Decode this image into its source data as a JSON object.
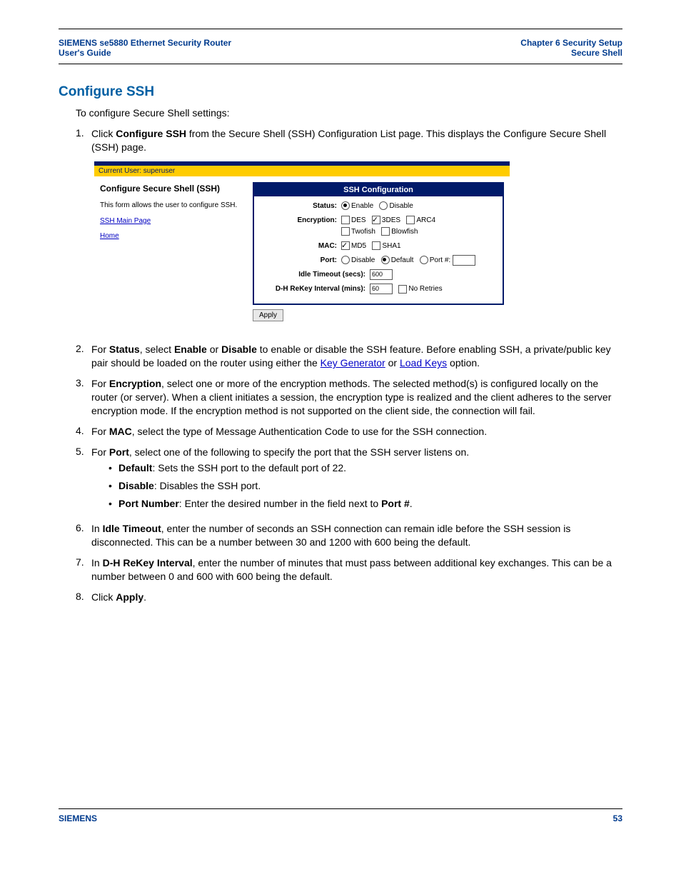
{
  "header": {
    "left1": "SIEMENS se5880 Ethernet Security Router",
    "left2": "User's Guide",
    "right1": "Chapter 6  Security Setup",
    "right2": "Secure Shell"
  },
  "section_title": "Configure SSH",
  "intro": "To configure Secure Shell settings:",
  "steps": {
    "s1a": "Click ",
    "s1b": "Configure SSH",
    "s1c": " from the Secure Shell (SSH) Configuration List page. This displays the Configure Secure Shell (SSH) page.",
    "s2a": "For ",
    "s2b": "Status",
    "s2c": ", select ",
    "s2d": "Enable",
    "s2e": " or ",
    "s2f": "Disable",
    "s2g": " to enable or disable the SSH feature. Before enabling SSH, a private/public key pair should be loaded on the router using either the ",
    "s2h": "Key Generator",
    "s2i": " or ",
    "s2j": "Load Keys",
    "s2k": " option.",
    "s3a": "For ",
    "s3b": "Encryption",
    "s3c": ", select one or more of the encryption methods. The selected method(s) is configured locally on the router (or server). When a client initiates a session, the encryption type is realized and the client adheres to the server encryption mode. If the encryption method is not supported on the client side, the connection will fail.",
    "s4a": "For ",
    "s4b": "MAC",
    "s4c": ", select the type of Message Authentication Code to use for the SSH connection.",
    "s5a": "For ",
    "s5b": "Port",
    "s5c": ", select one of the following to specify the port that the SSH server listens on.",
    "b1a": "Default",
    "b1b": ": Sets the SSH port to the default port of 22.",
    "b2a": "Disable",
    "b2b": ": Disables the SSH port.",
    "b3a": "Port Number",
    "b3b": ": Enter the desired number in the field next to ",
    "b3c": "Port #",
    "b3d": ".",
    "s6a": "In ",
    "s6b": "Idle Timeout",
    "s6c": ", enter the number of seconds an SSH connection can remain idle before the SSH session is disconnected. This can be a number between 30 and 1200 with 600 being the default.",
    "s7a": "In ",
    "s7b": "D-H ReKey Interval",
    "s7c": ", enter the number of minutes that must pass between additional key exchanges. This can be a number between 0 and 600 with 600 being the default.",
    "s8a": "Click ",
    "s8b": "Apply",
    "s8c": "."
  },
  "ss": {
    "userbar": "Current User: superuser",
    "panel_title": "Configure Secure Shell (SSH)",
    "panel_desc": "This form allows the user to configure SSH.",
    "link_main": "SSH Main Page",
    "link_home": "Home",
    "table_hdr": "SSH Configuration",
    "lbl_status": "Status:",
    "opt_enable": "Enable",
    "opt_disable": "Disable",
    "lbl_enc": "Encryption:",
    "enc_des": "DES",
    "enc_3des": "3DES",
    "enc_arc4": "ARC4",
    "enc_twofish": "Twofish",
    "enc_blowfish": "Blowfish",
    "lbl_mac": "MAC:",
    "mac_md5": "MD5",
    "mac_sha1": "SHA1",
    "lbl_port": "Port:",
    "port_disable": "Disable",
    "port_default": "Default",
    "port_num": "Port #:",
    "lbl_idle": "Idle Timeout (secs):",
    "val_idle": "600",
    "lbl_rekey": "D-H ReKey Interval (mins):",
    "val_rekey": "60",
    "noretries": "No Retries",
    "apply": "Apply"
  },
  "footer": {
    "brand": "SIEMENS",
    "page": "53"
  }
}
